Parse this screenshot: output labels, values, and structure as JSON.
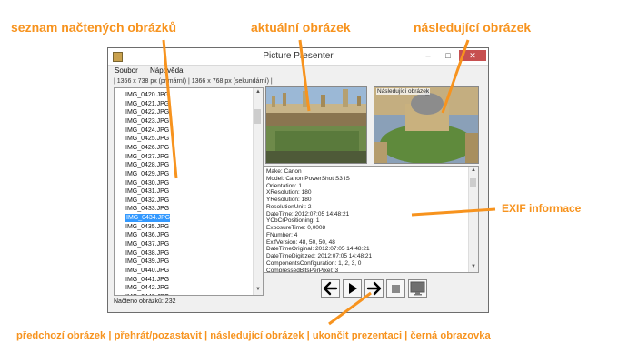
{
  "annotations": {
    "list": "seznam načtených obrázků",
    "current": "aktuální obrázek",
    "next": "následující obrázek",
    "exif": "EXIF informace",
    "controls": "předchozí obrázek | přehrát/pozastavit | následující obrázek | ukončit prezentaci | černá obrazovka"
  },
  "window": {
    "title": "Picture Presenter",
    "minimize_icon": "minimize-icon",
    "maximize_icon": "maximize-icon",
    "close_icon": "close-icon"
  },
  "menu": [
    "Soubor",
    "Nápověda"
  ],
  "info": "| 1366 x 738 px (primární) | 1366 x 768 px (sekundární) |",
  "files": [
    "IMG_0420.JPG",
    "IMG_0421.JPG",
    "IMG_0422.JPG",
    "IMG_0423.JPG",
    "IMG_0424.JPG",
    "IMG_0425.JPG",
    "IMG_0426.JPG",
    "IMG_0427.JPG",
    "IMG_0428.JPG",
    "IMG_0429.JPG",
    "IMG_0430.JPG",
    "IMG_0431.JPG",
    "IMG_0432.JPG",
    "IMG_0433.JPG",
    "IMG_0434.JPG",
    "IMG_0435.JPG",
    "IMG_0436.JPG",
    "IMG_0437.JPG",
    "IMG_0438.JPG",
    "IMG_0439.JPG",
    "IMG_0440.JPG",
    "IMG_0441.JPG",
    "IMG_0442.JPG",
    "IMG_0443.JPG"
  ],
  "selected_file": "IMG_0434.JPG",
  "next_label": "Následující obrázek",
  "exif": [
    "Make: Canon",
    "Model: Canon PowerShot S3 IS",
    "Orientation: 1",
    "XResolution: 180",
    "YResolution: 180",
    "ResolutionUnit: 2",
    "DateTime: 2012:07:05 14:48:21",
    "YCbCrPositioning: 1",
    "ExposureTime: 0,0008",
    "FNumber: 4",
    "ExifVersion: 48, 50, 50, 48",
    "DateTimeOriginal: 2012:07:05 14:48:21",
    "DateTimeDigitized: 2012:07:05 14:48:21",
    "ComponentsConfiguration: 1, 2, 3, 0",
    "CompressedBitsPerPixel: 3"
  ],
  "controls": {
    "prev_icon": "arrow-left-icon",
    "play_icon": "play-icon",
    "next_icon": "arrow-right-icon",
    "stop_icon": "stop-icon",
    "black_icon": "monitor-icon"
  },
  "status": "Načteno obrázků: 232",
  "colors": {
    "annotation": "#f7931e",
    "selection": "#3399ff"
  }
}
